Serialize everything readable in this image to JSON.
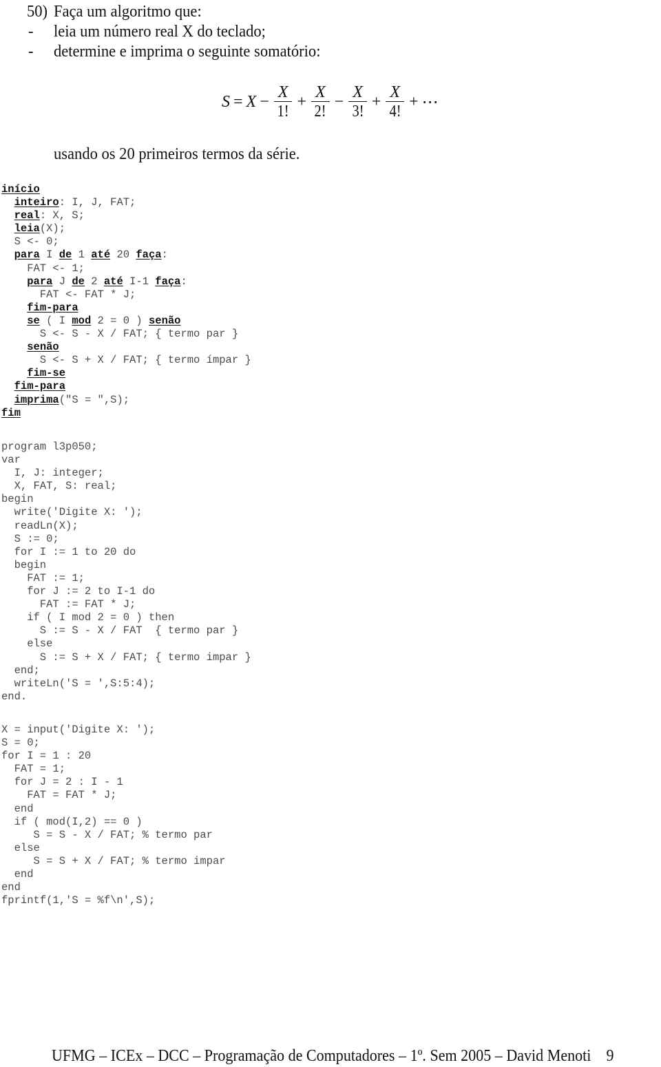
{
  "exercise": {
    "number": "50)",
    "title": "Faça um algoritmo que:",
    "items": [
      {
        "bullet": "-",
        "text": "leia um número real X do teclado;"
      },
      {
        "bullet": "-",
        "text": "determine e imprima o seguinte somatório:"
      }
    ],
    "formula": {
      "lhs": "S",
      "eq": "=",
      "first": "X",
      "terms": [
        {
          "op": "−",
          "num": "X",
          "den": "1!"
        },
        {
          "op": "+",
          "num": "X",
          "den": "2!"
        },
        {
          "op": "−",
          "num": "X",
          "den": "3!"
        },
        {
          "op": "+",
          "num": "X",
          "den": "4!"
        }
      ],
      "tail_op": "+",
      "ellipsis": "⋯"
    },
    "footnote": "usando os 20 primeiros termos da série."
  },
  "pseudocode": {
    "lines": [
      [
        {
          "k": "início"
        }
      ],
      [
        {
          "t": "  "
        },
        {
          "k": "inteiro"
        },
        {
          "t": ": I, J, FAT;"
        }
      ],
      [
        {
          "t": "  "
        },
        {
          "k": "real"
        },
        {
          "t": ": X, S;"
        }
      ],
      [
        {
          "t": "  "
        },
        {
          "k": "leia"
        },
        {
          "t": "(X);"
        }
      ],
      [
        {
          "t": "  S <- 0;"
        }
      ],
      [
        {
          "t": "  "
        },
        {
          "k": "para"
        },
        {
          "t": " I "
        },
        {
          "k": "de"
        },
        {
          "t": " 1 "
        },
        {
          "k": "até"
        },
        {
          "t": " 20 "
        },
        {
          "k": "faça"
        },
        {
          "t": ":"
        }
      ],
      [
        {
          "t": "    FAT <- 1;"
        }
      ],
      [
        {
          "t": "    "
        },
        {
          "k": "para"
        },
        {
          "t": " J "
        },
        {
          "k": "de"
        },
        {
          "t": " 2 "
        },
        {
          "k": "até"
        },
        {
          "t": " I-1 "
        },
        {
          "k": "faça"
        },
        {
          "t": ":"
        }
      ],
      [
        {
          "t": "      FAT <- FAT * J;"
        }
      ],
      [
        {
          "t": "    "
        },
        {
          "k": "fim-para"
        }
      ],
      [
        {
          "t": "    "
        },
        {
          "k": "se"
        },
        {
          "t": " ( I "
        },
        {
          "k": "mod"
        },
        {
          "t": " 2 = 0 ) "
        },
        {
          "k": "senão"
        }
      ],
      [
        {
          "t": "      S <- S - X / FAT; { termo par }"
        }
      ],
      [
        {
          "t": "    "
        },
        {
          "k": "senão"
        }
      ],
      [
        {
          "t": "      S <- S + X / FAT; { termo ímpar }"
        }
      ],
      [
        {
          "t": "    "
        },
        {
          "k": "fim-se"
        }
      ],
      [
        {
          "t": "  "
        },
        {
          "k": "fim-para"
        }
      ],
      [
        {
          "t": "  "
        },
        {
          "k": "imprima"
        },
        {
          "t": "(\"S = \",S);"
        }
      ],
      [
        {
          "k": "fim"
        }
      ]
    ]
  },
  "pascal": {
    "lines": [
      "program l3p050;",
      "var",
      "  I, J: integer;",
      "  X, FAT, S: real;",
      "begin",
      "  write('Digite X: ');",
      "  readLn(X);",
      "  S := 0;",
      "  for I := 1 to 20 do",
      "  begin",
      "    FAT := 1;",
      "    for J := 2 to I-1 do",
      "      FAT := FAT * J;",
      "    if ( I mod 2 = 0 ) then",
      "      S := S - X / FAT  { termo par }",
      "    else",
      "      S := S + X / FAT; { termo impar }",
      "  end;",
      "  writeLn('S = ',S:5:4);",
      "end."
    ]
  },
  "matlab": {
    "lines": [
      "X = input('Digite X: ');",
      "S = 0;",
      "for I = 1 : 20",
      "  FAT = 1;",
      "  for J = 2 : I - 1",
      "    FAT = FAT * J;",
      "  end",
      "  if ( mod(I,2) == 0 )",
      "     S = S - X / FAT; % termo par",
      "  else",
      "     S = S + X / FAT; % termo impar",
      "  end",
      "end",
      "fprintf(1,'S = %f\\n',S);"
    ]
  },
  "footer": "UFMG – ICEx – DCC – Programação de Computadores – 1º. Sem 2005 – David Menoti    9"
}
